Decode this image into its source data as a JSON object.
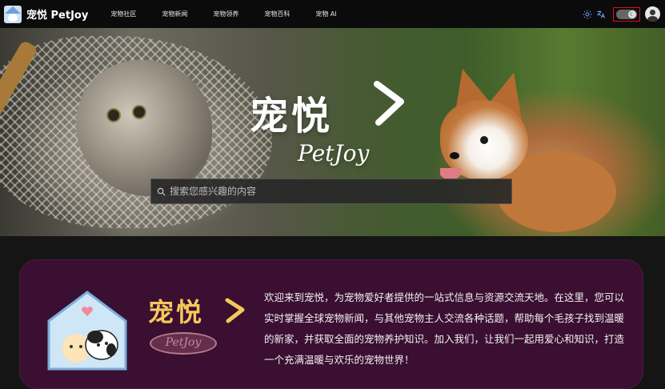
{
  "brand": {
    "name": "宠悦 PetJoy"
  },
  "nav": {
    "items": [
      {
        "label": "宠物社区"
      },
      {
        "label": "宠物新闻"
      },
      {
        "label": "宠物领养"
      },
      {
        "label": "宠物百科"
      },
      {
        "label": "宠物 AI"
      }
    ]
  },
  "toolbar": {
    "icons": [
      "sun-icon",
      "translate-icon",
      "theme-toggle",
      "avatar"
    ],
    "toggle_state": "dark",
    "accent": "#6ea8ff",
    "highlight_color": "#dd1111"
  },
  "hero": {
    "title": "宠悦",
    "subtitle": "PetJoy",
    "search_placeholder": "搜索您感兴趣的内容"
  },
  "info": {
    "brand_title": "宠悦",
    "brand_sub": "PetJoy",
    "description": "欢迎来到宠悦，为宠物爱好者提供的一站式信息与资源交流天地。在这里，您可以实时掌握全球宠物新闻，与其他宠物主人交流各种话题，帮助每个毛孩子找到温暖的新家，并获取全面的宠物养护知识。加入我们，让我们一起用爱心和知识，打造一个充满温暖与欢乐的宠物世界！",
    "card_color": "#3a0f31",
    "brand_color": "#f4c85a"
  }
}
